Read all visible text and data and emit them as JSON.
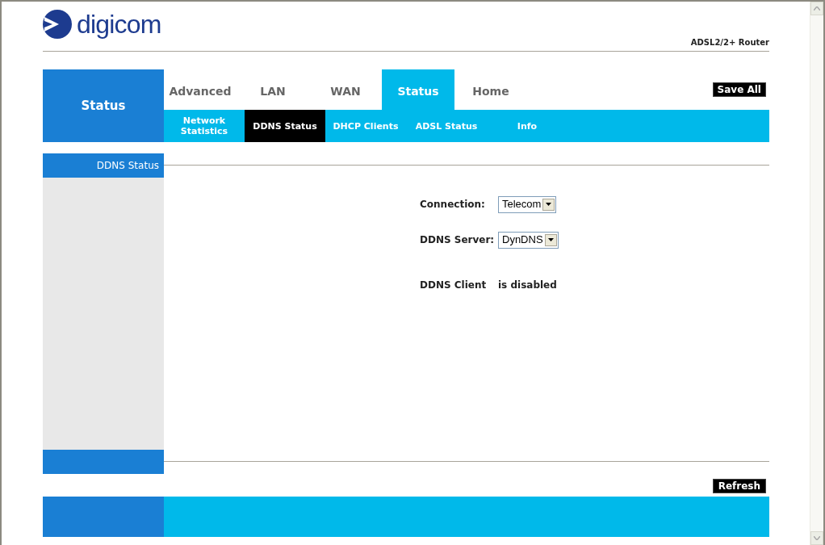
{
  "logo": {
    "text": "digicom"
  },
  "product": "ADSL2/2+ Router",
  "section_title": "Status",
  "tabs": [
    {
      "label": "Advanced",
      "selected": false
    },
    {
      "label": "LAN",
      "selected": false
    },
    {
      "label": "WAN",
      "selected": false
    },
    {
      "label": "Status",
      "selected": true
    },
    {
      "label": "Home",
      "selected": false
    }
  ],
  "save_button": "Save All",
  "subtabs": [
    {
      "label": "Network Statistics",
      "selected": false
    },
    {
      "label": "DDNS Status",
      "selected": true
    },
    {
      "label": "DHCP Clients",
      "selected": false
    },
    {
      "label": "ADSL Status",
      "selected": false
    },
    {
      "label": "Info",
      "selected": false
    }
  ],
  "sidebar": {
    "items": [
      {
        "label": "DDNS Status",
        "selected": true
      }
    ]
  },
  "form": {
    "fields": [
      {
        "label": "Connection:",
        "value": "Telecom"
      },
      {
        "label": "DDNS Server:",
        "value": "DynDNS"
      }
    ],
    "client": {
      "label": "DDNS Client",
      "value": "is disabled"
    }
  },
  "refresh_button": "Refresh"
}
